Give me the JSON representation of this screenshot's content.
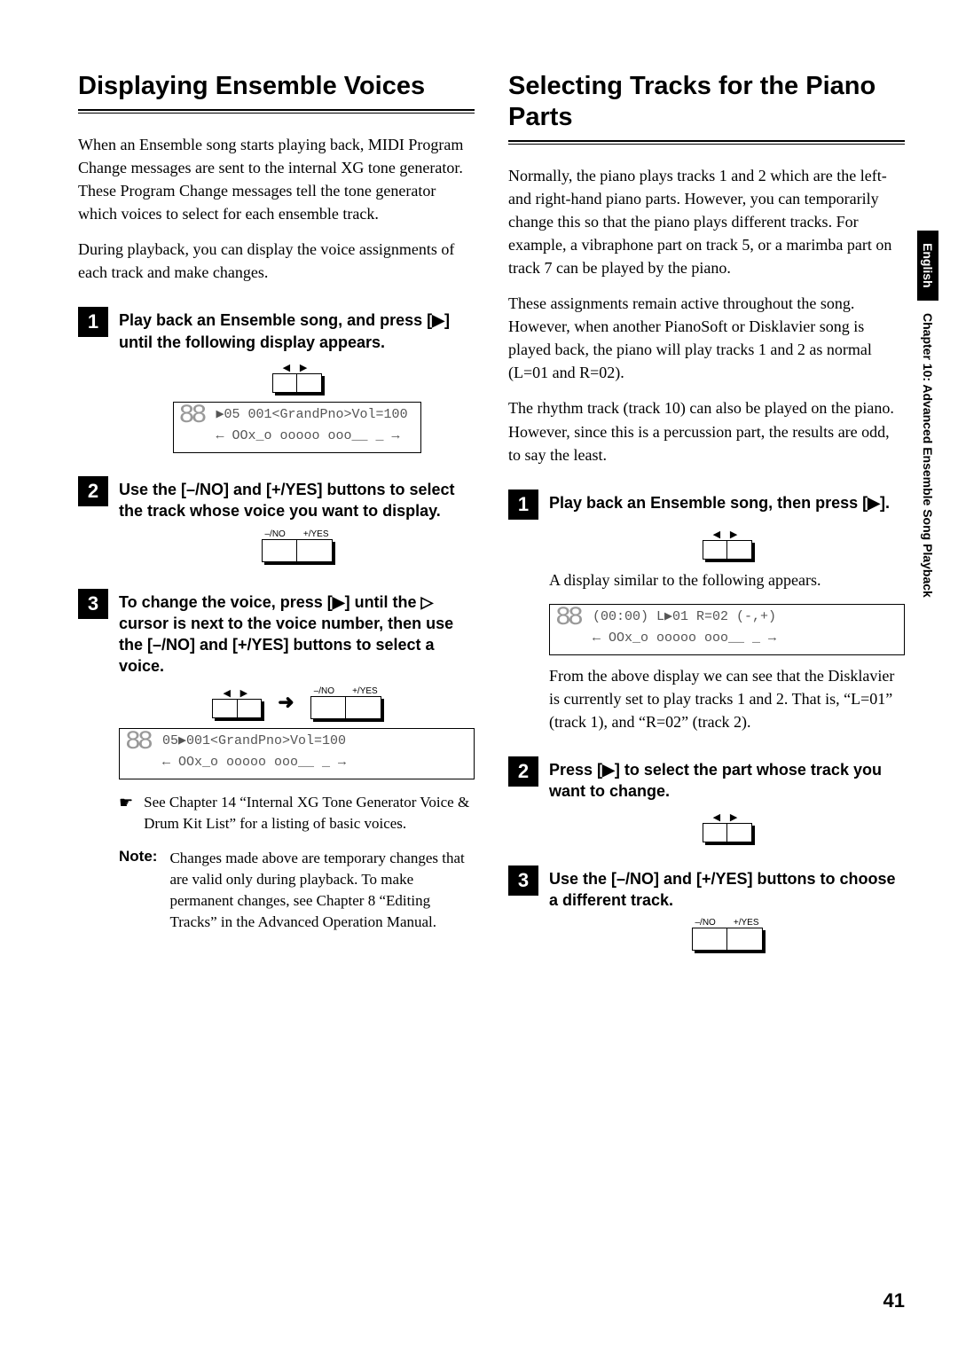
{
  "side": {
    "language": "English",
    "chapter": "Chapter 10: Advanced Ensemble Song Playback"
  },
  "page_number": "41",
  "left": {
    "title": "Displaying Ensemble Voices",
    "p1": "When an Ensemble song starts playing back, MIDI Program Change messages are sent to the internal XG tone generator. These Program Change messages tell the tone generator which voices to select for each ensemble track.",
    "p2": "During playback, you can display the voice assignments of each track and make changes.",
    "step1_num": "1",
    "step1_text": "Play back an Ensemble song, and press [▶] until the following display appears.",
    "lcd1_l1": "▶05 001<GrandPno>Vol=100",
    "lcd1_l2": "← OOx_o ooooo ooo__ _   →",
    "step2_num": "2",
    "step2_text": "Use the [–/NO] and [+/YES] buttons to select the track whose voice you want to display.",
    "btn_no": "–/NO",
    "btn_yes": "+/YES",
    "step3_num": "3",
    "step3_text": "To change the voice, press [▶] until the ▷ cursor is next to the voice number, then use the [–/NO] and [+/YES] buttons to select a voice.",
    "lcd2_l1": "05▶001<GrandPno>Vol=100",
    "lcd2_l2": "← OOx_o ooooo ooo__ _   →",
    "ref_hand": "☛",
    "ref_text": "See Chapter 14 “Internal XG Tone Generator Voice & Drum Kit List” for a listing of basic voices.",
    "note_label": "Note:",
    "note_text": "Changes made above are temporary changes that are valid only during playback. To make permanent changes, see Chapter 8 “Editing Tracks” in the Advanced Operation Manual.",
    "rocker_lr": "◀ ▶"
  },
  "right": {
    "title": "Selecting Tracks for the Piano Parts",
    "p1": "Normally, the piano plays tracks 1 and 2 which are the left- and right-hand piano parts. However, you can temporarily change this so that the piano plays different tracks. For example, a vibraphone part on track 5, or a marimba part on track 7 can be played by the piano.",
    "p2": "These assignments remain active throughout the song. However, when another PianoSoft or Disklavier song is played back, the piano will play tracks 1 and 2 as normal (L=01 and R=02).",
    "p3": "The rhythm track (track 10) can also be played on the piano. However, since this is a percussion part, the results are odd, to say the least.",
    "step1_num": "1",
    "step1_text": "Play back an Ensemble song, then press [▶].",
    "caption1": "A display similar to the following appears.",
    "lcd_l1": "(00:00) L▶01 R=02  (-,+)",
    "lcd_l2": "← OOx_o ooooo ooo__ _   →",
    "after_lcd": "From the above display we can see that the Disklavier is currently set to play tracks 1 and 2. That is, “L=01” (track 1), and “R=02” (track 2).",
    "step2_num": "2",
    "step2_text": "Press [▶] to select the part whose track you want to change.",
    "step3_num": "3",
    "step3_text": "Use the [–/NO] and [+/YES] buttons to choose a different track.",
    "btn_no": "–/NO",
    "btn_yes": "+/YES"
  },
  "eights": "88"
}
